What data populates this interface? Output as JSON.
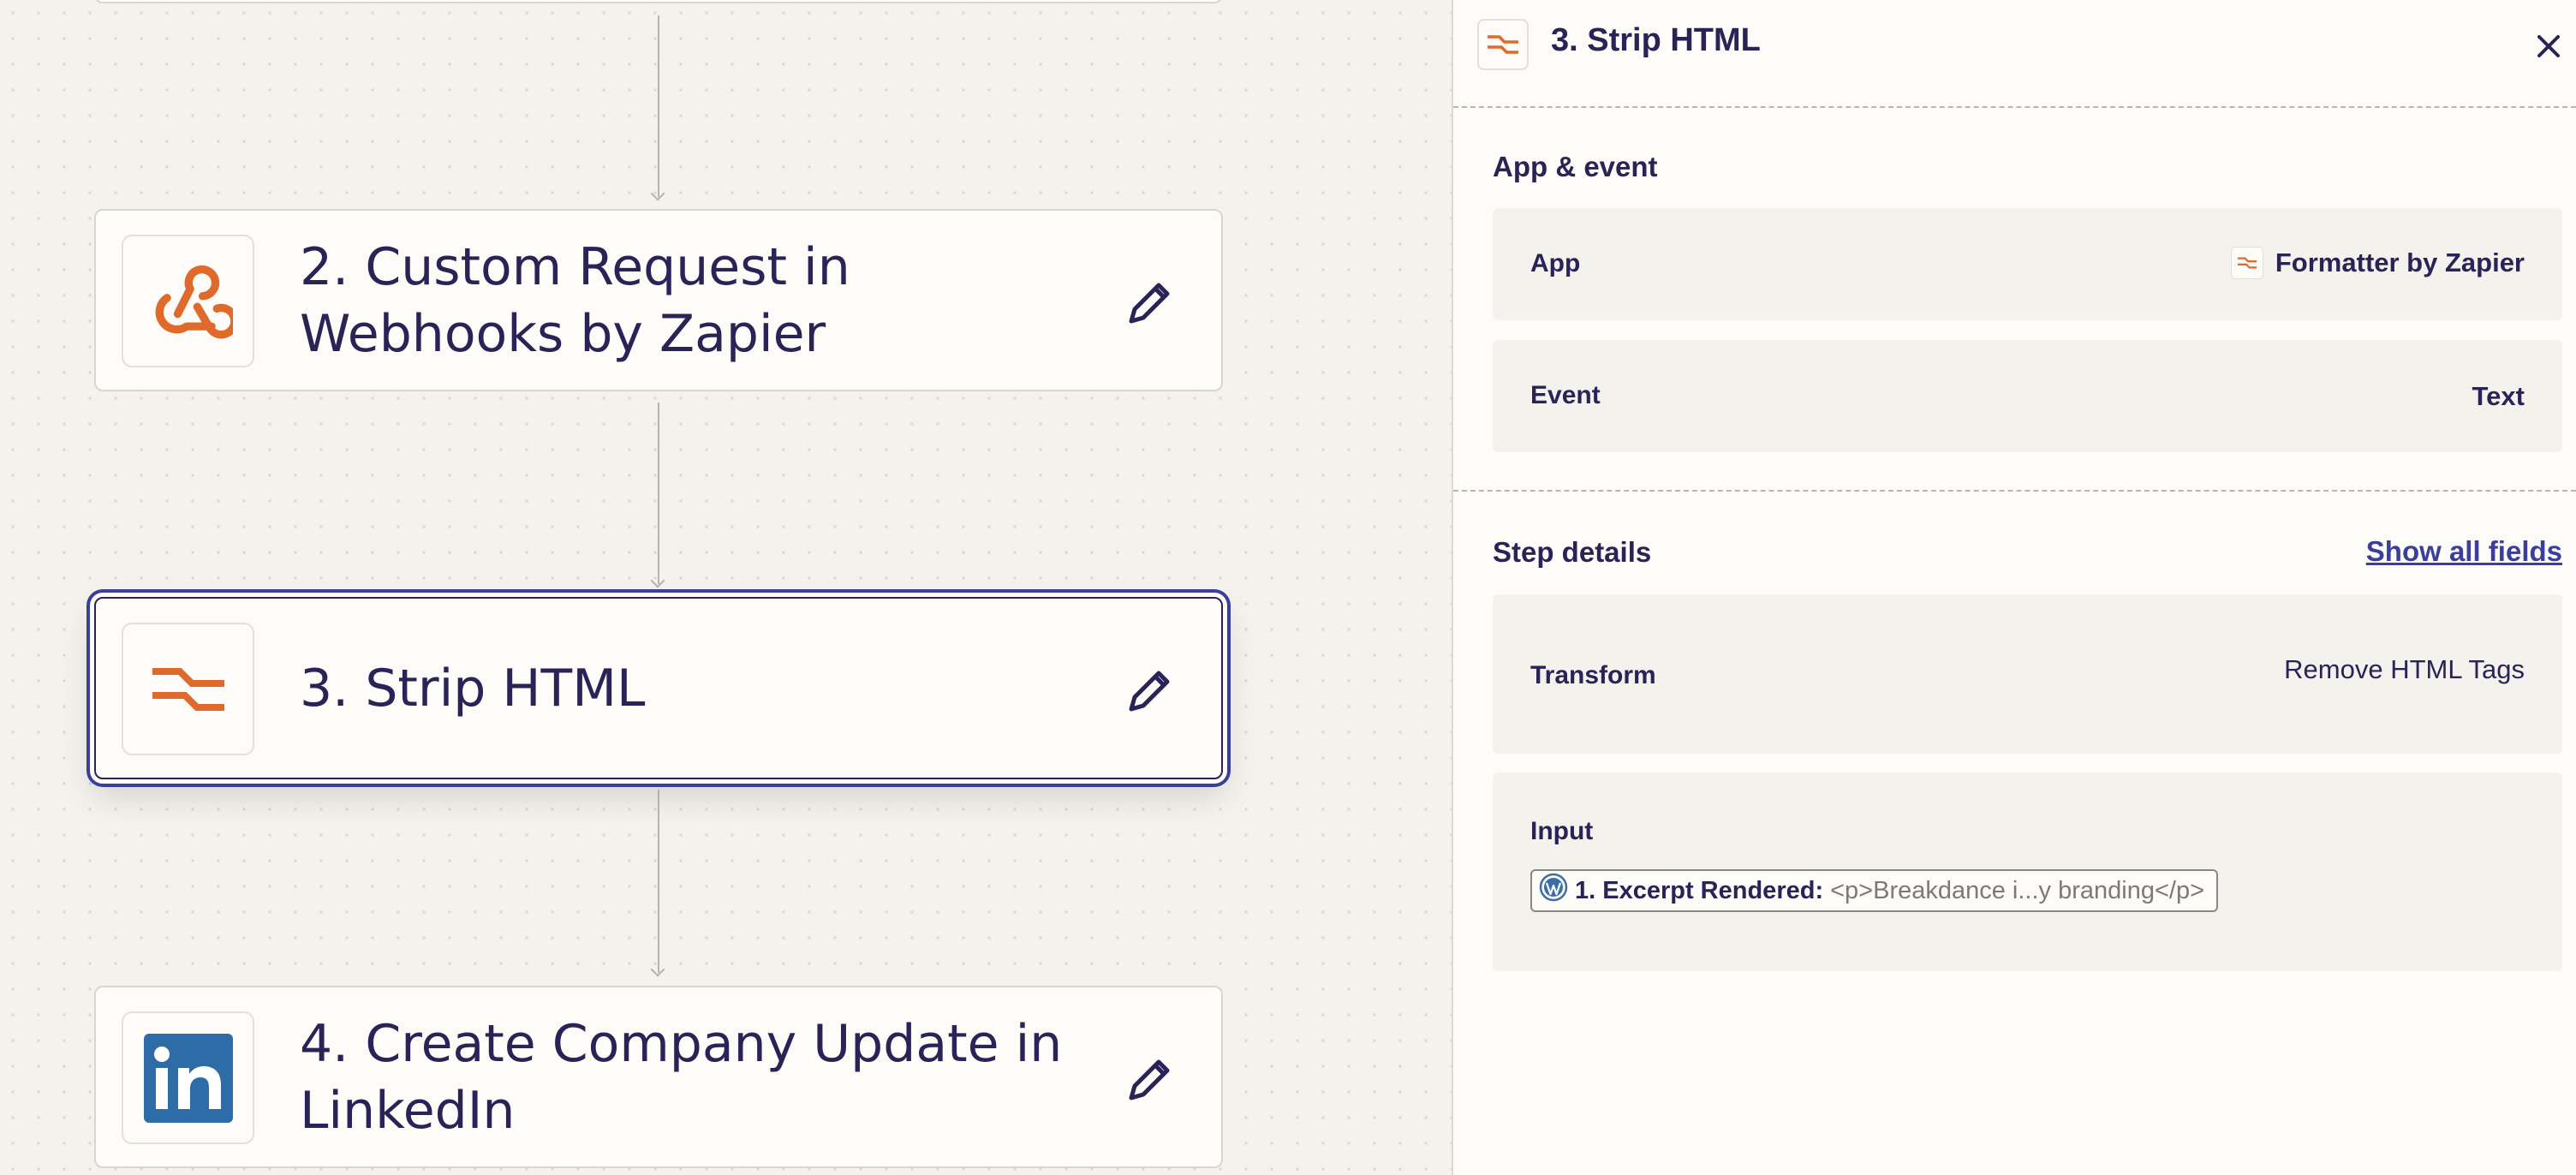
{
  "canvas": {
    "steps": [
      {
        "title": "2. Custom Request in Webhooks by Zapier",
        "icon": "webhooks-icon"
      },
      {
        "title": "3. Strip HTML",
        "icon": "formatter-icon",
        "selected": true
      },
      {
        "title": "4. Create Company Update in LinkedIn",
        "icon": "linkedin-icon"
      }
    ]
  },
  "panel": {
    "title": "3. Strip HTML",
    "app_event_heading": "App & event",
    "app_label": "App",
    "app_value": "Formatter by Zapier",
    "event_label": "Event",
    "event_value": "Text",
    "step_details_heading": "Step details",
    "show_all_fields": "Show all fields",
    "transform_label": "Transform",
    "transform_value": "Remove HTML Tags",
    "input_label": "Input",
    "input_pill_label": "1. Excerpt Rendered:",
    "input_pill_value": "<p>Breakdance i...y branding</p>"
  },
  "colors": {
    "brand_orange": "#e06a2c",
    "ink": "#2b2358",
    "accent_blue": "#3a3f9c",
    "linkedin_blue": "#2d6ca7"
  }
}
